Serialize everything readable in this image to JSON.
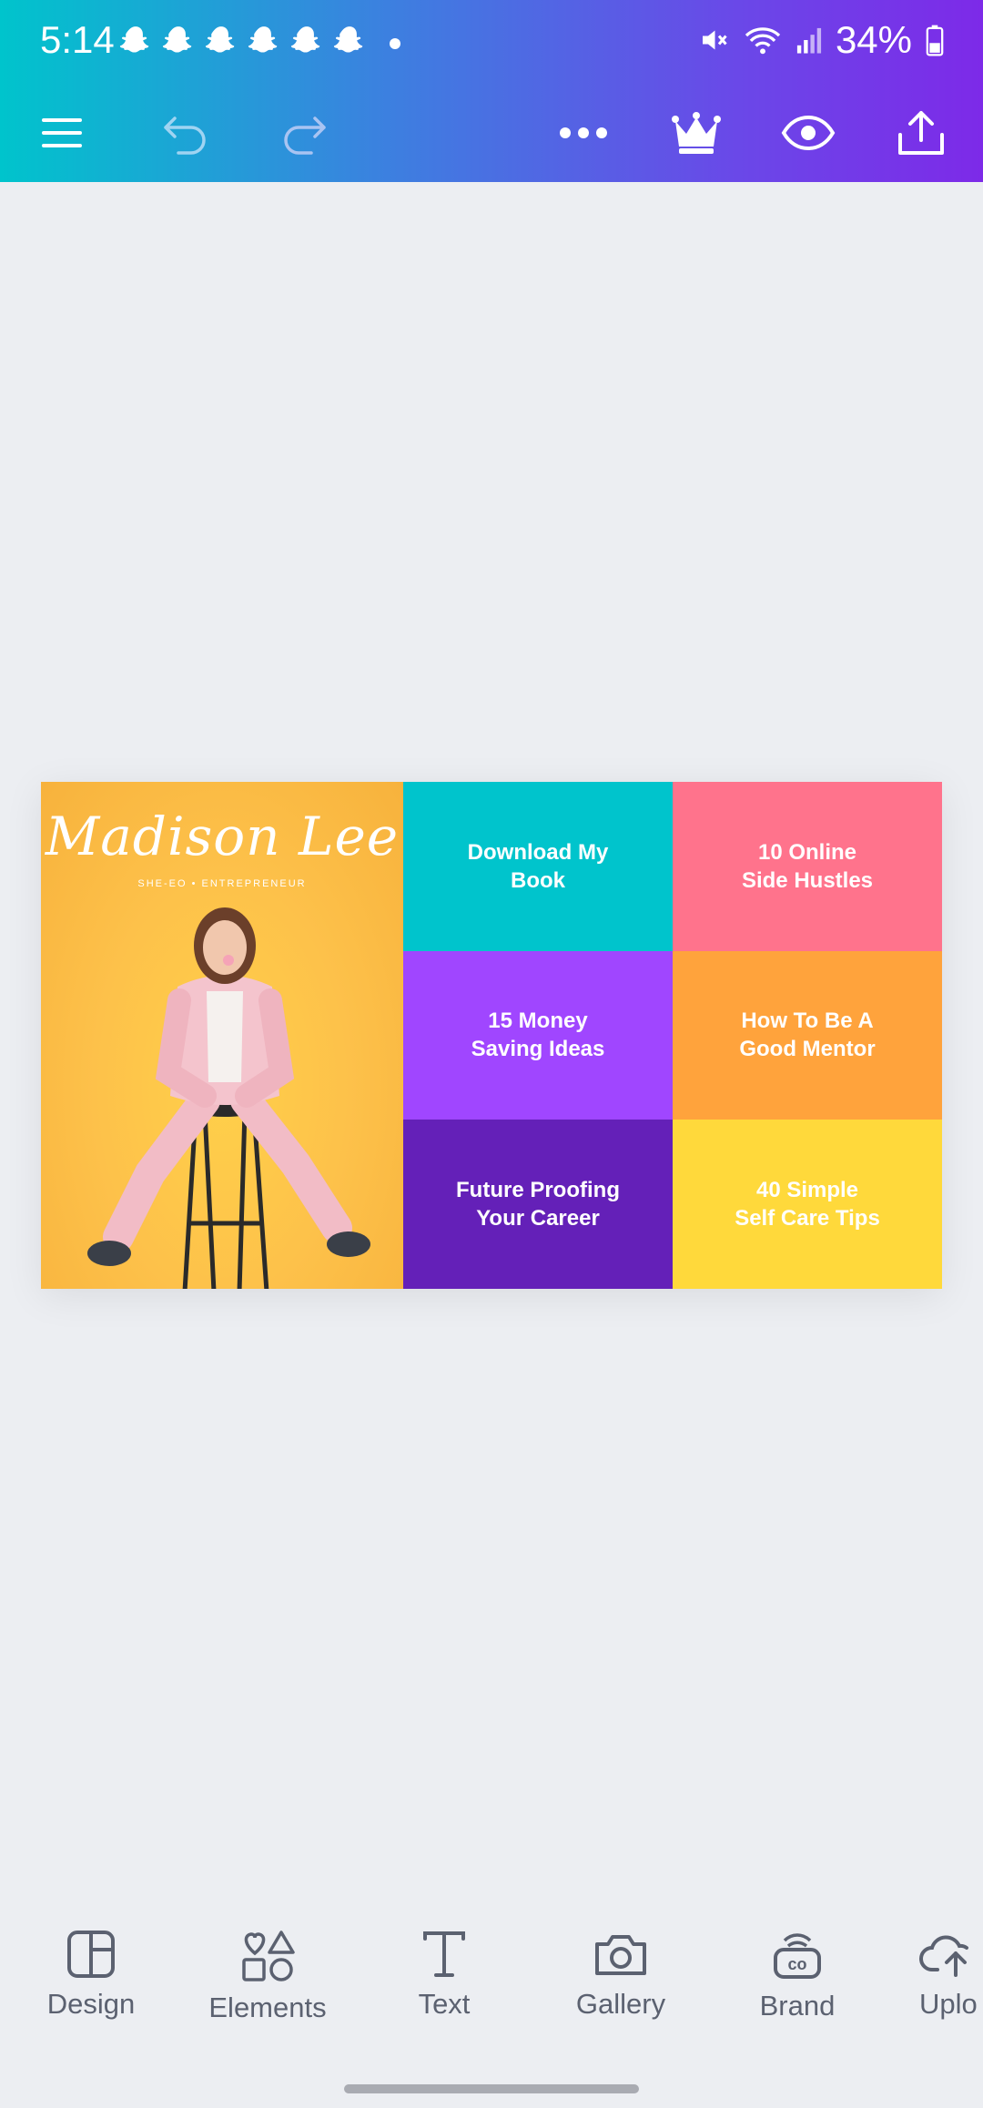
{
  "status_bar": {
    "time": "5:14",
    "notification_icons": [
      "snapchat-icon",
      "snapchat-icon",
      "snapchat-icon",
      "snapchat-icon",
      "snapchat-icon",
      "snapchat-icon"
    ],
    "battery_percent": "34%"
  },
  "toolbar": {
    "menu_icon": "hamburger-icon",
    "undo_icon": "undo-icon",
    "redo_icon": "redo-icon",
    "more_icon": "more-icon",
    "premium_icon": "crown-icon",
    "preview_icon": "eye-icon",
    "share_icon": "share-icon"
  },
  "design": {
    "logo_name": "Madison Lee",
    "logo_tagline": "SHE-EO  •  ENTREPRENEUR",
    "tiles": [
      {
        "label": "Download My\nBook",
        "color": "#00c4cc"
      },
      {
        "label": "10 Online\nSide Hustles",
        "color": "#ff738c"
      },
      {
        "label": "15 Money\nSaving Ideas",
        "color": "#a046ff"
      },
      {
        "label": "How To Be A\nGood Mentor",
        "color": "#ffa33c"
      },
      {
        "label": "Future Proofing\nYour Career",
        "color": "#6420b8"
      },
      {
        "label": "40 Simple\nSelf Care Tips",
        "color": "#ffd93b"
      }
    ]
  },
  "bottom_nav": {
    "items": [
      {
        "label": "Design",
        "icon": "design-icon"
      },
      {
        "label": "Elements",
        "icon": "elements-icon"
      },
      {
        "label": "Text",
        "icon": "text-icon"
      },
      {
        "label": "Gallery",
        "icon": "camera-icon"
      },
      {
        "label": "Brand",
        "icon": "brand-icon"
      },
      {
        "label": "Uplo",
        "icon": "upload-icon"
      }
    ]
  },
  "colors": {
    "header_gradient_start": "#00c4cc",
    "header_gradient_end": "#7d2ae8",
    "background": "#eceef2"
  }
}
